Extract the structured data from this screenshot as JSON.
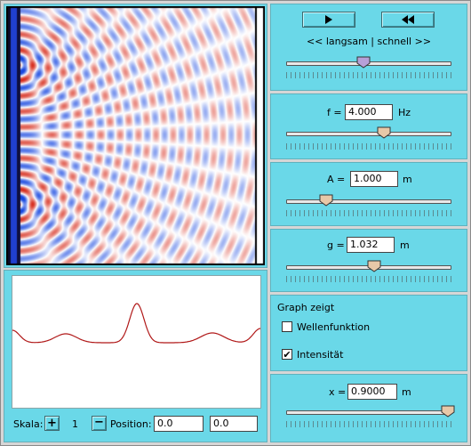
{
  "speed": {
    "label_slow_fast": "<< langsam | schnell >>",
    "play_icon": "play-icon",
    "rewind_icon": "rewind-icon",
    "level": 0.47
  },
  "frequency": {
    "label": "f =",
    "value": "4.000",
    "unit": "Hz",
    "level": 0.59
  },
  "amplitude": {
    "label": "A =",
    "value": "1.000",
    "unit": "m",
    "level": 0.24
  },
  "gap": {
    "label": "g =",
    "value": "1.032",
    "unit": "m",
    "level": 0.53
  },
  "graph_mode": {
    "title": "Graph zeigt",
    "options": [
      {
        "label": "Wellenfunktion",
        "checked": false
      },
      {
        "label": "Intensität",
        "checked": true
      }
    ]
  },
  "position_x": {
    "label": "x =",
    "value": "0.9000",
    "unit": "m",
    "level": 0.98
  },
  "graph_controls": {
    "scale_label": "Skala:",
    "scale_value": "1",
    "position_label": "Position:",
    "position_value_1": "0.0",
    "position_value_2": "0.0"
  },
  "colors": {
    "panel": "#6ad8e8",
    "wave_positive": "#d62010",
    "wave_negative": "#1050e0",
    "graph_line": "#b01818"
  }
}
